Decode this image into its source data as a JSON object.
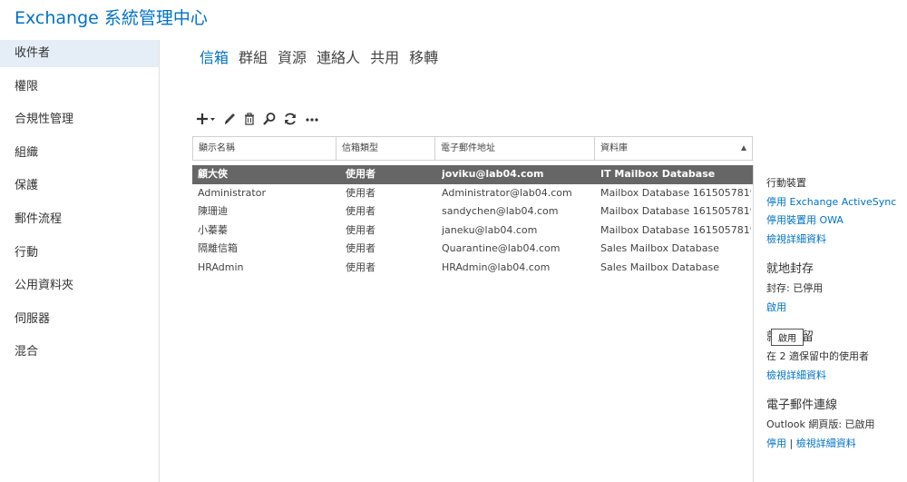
{
  "app": {
    "title": "Exchange 系統管理中心"
  },
  "left_nav": {
    "items": [
      {
        "label": "收件者"
      },
      {
        "label": "權限"
      },
      {
        "label": "合規性管理"
      },
      {
        "label": "組織"
      },
      {
        "label": "保護"
      },
      {
        "label": "郵件流程"
      },
      {
        "label": "行動"
      },
      {
        "label": "公用資料夾"
      },
      {
        "label": "伺服器"
      },
      {
        "label": "混合"
      }
    ],
    "active_index": 0
  },
  "tabs": [
    {
      "label": "信箱"
    },
    {
      "label": "群組"
    },
    {
      "label": "資源"
    },
    {
      "label": "連絡人"
    },
    {
      "label": "共用"
    },
    {
      "label": "移轉"
    }
  ],
  "toolbar": {
    "icons": [
      "add-icon",
      "edit-icon",
      "delete-icon",
      "search-icon",
      "refresh-icon",
      "more-icon"
    ]
  },
  "table": {
    "columns": [
      "顯示名稱",
      "信箱類型",
      "電子郵件地址",
      "資料庫"
    ],
    "sorted_column": 3,
    "rows": [
      {
        "name": "顧大俠",
        "type": "使用者",
        "email": "joviku@lab04.com",
        "database": "IT Mailbox Database",
        "selected": true
      },
      {
        "name": "Administrator",
        "type": "使用者",
        "email": "Administrator@lab04.com",
        "database": "Mailbox Database 1615057819",
        "selected": false
      },
      {
        "name": "陳珊迪",
        "type": "使用者",
        "email": "sandychen@lab04.com",
        "database": "Mailbox Database 1615057819",
        "selected": false
      },
      {
        "name": "小蓁蓁",
        "type": "使用者",
        "email": "janeku@lab04.com",
        "database": "Mailbox Database 1615057819",
        "selected": false
      },
      {
        "name": "隔離信箱",
        "type": "使用者",
        "email": "Quarantine@lab04.com",
        "database": "Sales Mailbox Database",
        "selected": false
      },
      {
        "name": "HRAdmin",
        "type": "使用者",
        "email": "HRAdmin@lab04.com",
        "database": "Sales Mailbox Database",
        "selected": false
      }
    ]
  },
  "details": {
    "mobile": {
      "heading": "行動裝置",
      "disable_activesync": "停用 Exchange ActiveSync",
      "disable_owa": "停用裝置用 OWA",
      "view_details": "檢視詳細資料"
    },
    "archive": {
      "heading": "就地封存",
      "status": "封存: 已停用",
      "enable": "啟用"
    },
    "hold": {
      "heading": "就地保留",
      "status": "在 2 適保留中的使用者",
      "view_details": "檢視詳細資料"
    },
    "email_connectivity": {
      "heading": "電子郵件連線",
      "status": "Outlook 網頁版: 已啟用",
      "disable": "停用",
      "separator": "|",
      "view_details": "檢視詳細資料"
    }
  },
  "tooltip": {
    "text": "啟用"
  },
  "colors": {
    "accent": "#0072c6",
    "selected_row": "#666666",
    "active_nav": "#e5eef7"
  }
}
